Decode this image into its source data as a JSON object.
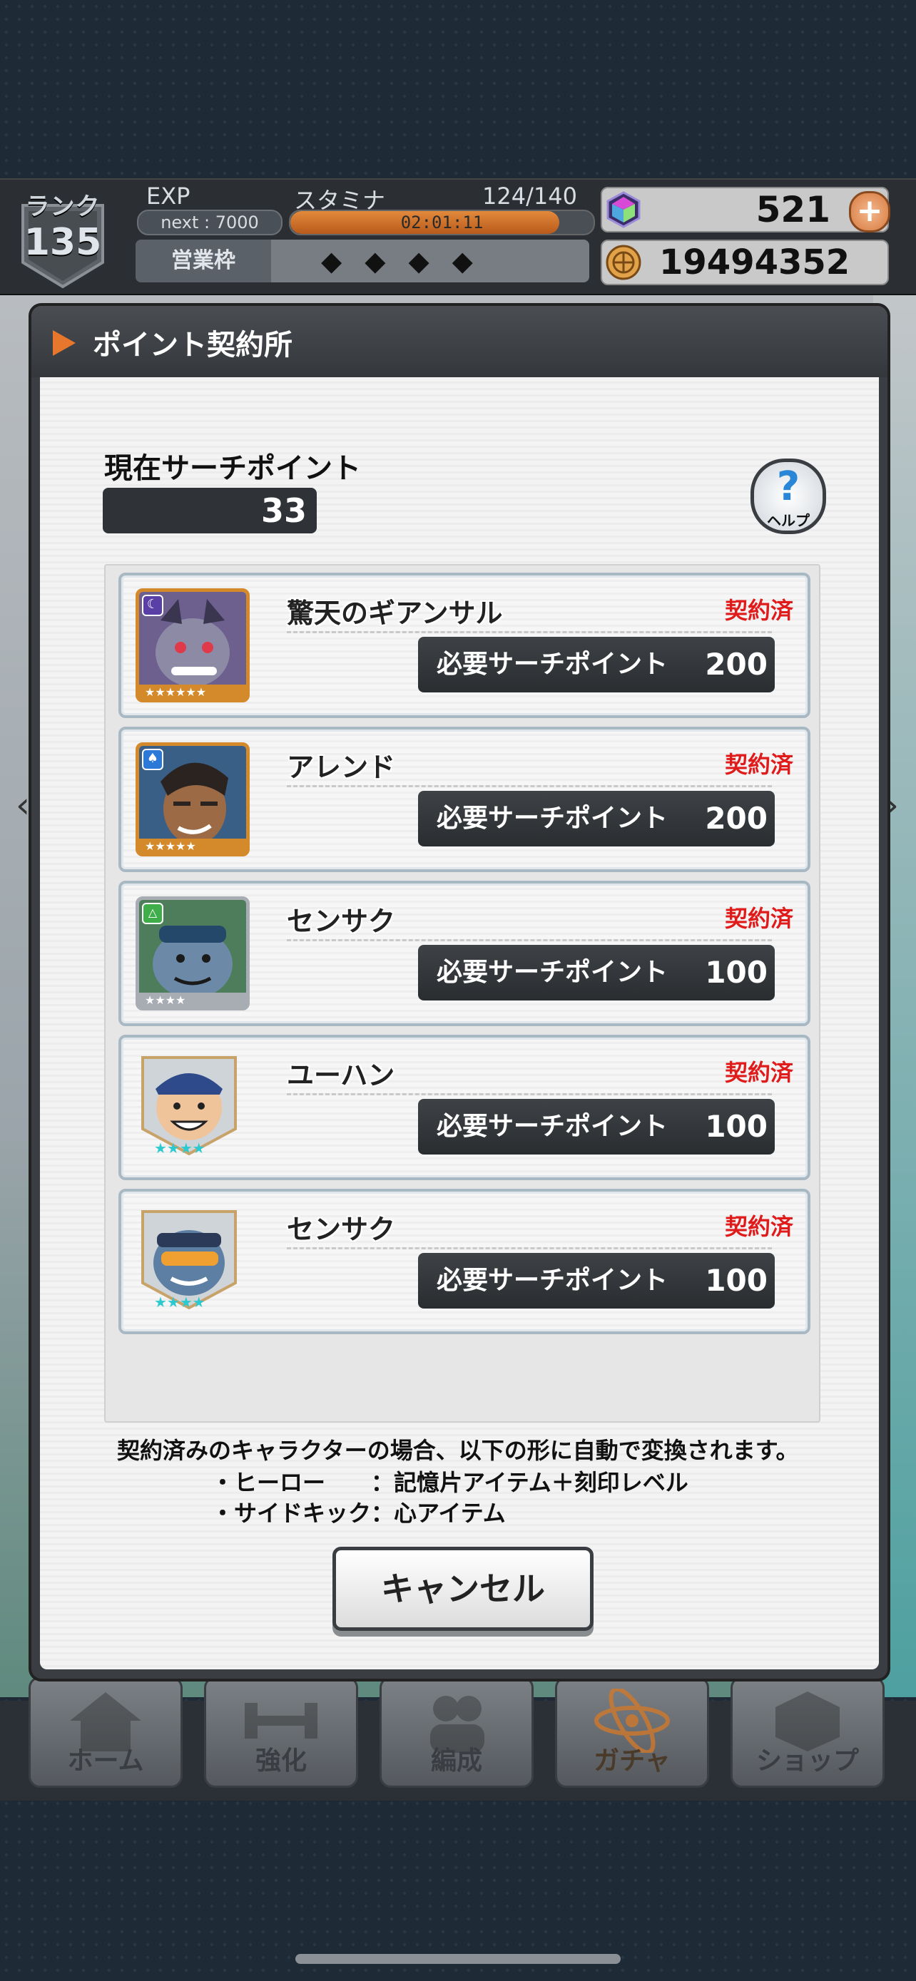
{
  "status": {
    "rank_label": "ランク",
    "rank": "135",
    "exp_label": "EXP",
    "exp_next": "next : 7000",
    "stamina_label": "スタミナ",
    "stamina_value": "124/140",
    "stamina_fraction": 0.886,
    "stamina_timer": "02:01:11",
    "eigyo_label": "営業枠",
    "eigyo_slots": "◆◆◆◆",
    "gems": "521",
    "coins": "19494352",
    "plus_symbol": "+"
  },
  "modal": {
    "title": "ポイント契約所",
    "search_points_label": "現在サーチポイント",
    "search_points": "33",
    "help_symbol": "?",
    "help_label": "ヘルプ",
    "cards": [
      {
        "name": "驚天のギアンサル",
        "status": "契約済",
        "cost_label": "必要サーチポイント",
        "cost": "200",
        "stars": 6,
        "type_icon": "moon-icon"
      },
      {
        "name": "アレンド",
        "status": "契約済",
        "cost_label": "必要サーチポイント",
        "cost": "200",
        "stars": 5,
        "type_icon": "spade-icon"
      },
      {
        "name": "センサク",
        "status": "契約済",
        "cost_label": "必要サーチポイント",
        "cost": "100",
        "stars": 4,
        "type_icon": "leaf-icon"
      },
      {
        "name": "ユーハン",
        "status": "契約済",
        "cost_label": "必要サーチポイント",
        "cost": "100",
        "stars": 4,
        "type_icon": "none"
      },
      {
        "name": "センサク",
        "status": "契約済",
        "cost_label": "必要サーチポイント",
        "cost": "100",
        "stars": 4,
        "type_icon": "none"
      }
    ],
    "note": "契約済みのキャラクターの場合、以下の形に自動で変換されます。",
    "note_hero": "・ヒーロー　　：記憶片アイテム＋刻印レベル",
    "note_sidekick": "・サイドキック：心アイテム",
    "cancel_label": "キャンセル"
  },
  "nav": [
    {
      "label": "ホーム"
    },
    {
      "label": "強化"
    },
    {
      "label": "編成"
    },
    {
      "label": "ガチャ"
    },
    {
      "label": "ショップ"
    }
  ],
  "colors": {
    "accent_orange": "#e8772e",
    "status_red": "#e01b1b",
    "panel_dark": "#2f3337"
  }
}
